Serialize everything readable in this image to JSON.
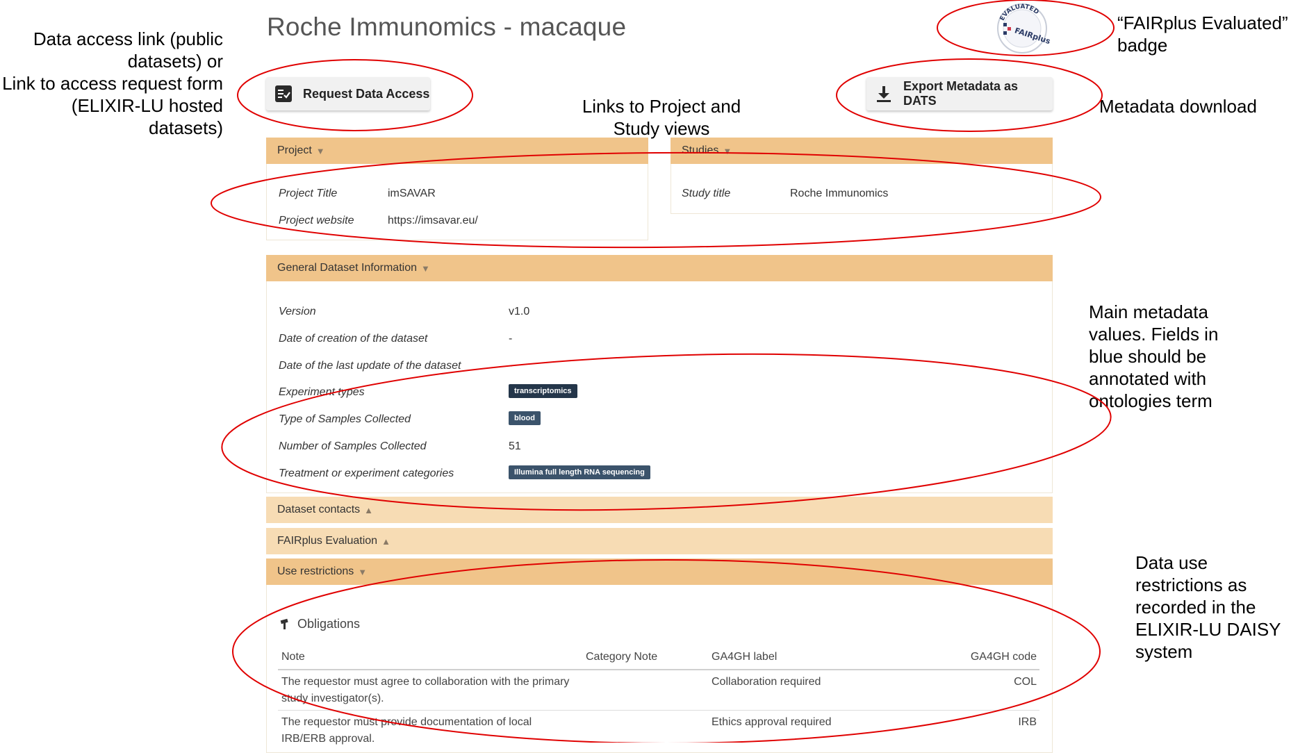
{
  "page": {
    "title": "Roche Immunomics - macaque"
  },
  "actions": {
    "request_access_label": "Request Data Access",
    "export_label": "Export Metadata as DATS"
  },
  "badge": {
    "top_text": "EVALUATED",
    "bottom_text": "FAIRplus"
  },
  "annotations": {
    "access_link": [
      "Data access link (public",
      "datasets) or",
      "Link to access request form",
      "(ELIXIR-LU hosted",
      "datasets)"
    ],
    "project_links": [
      "Links to Project and",
      "Study views"
    ],
    "fairplus_badge": [
      "“FAIRplus Evaluated”",
      "badge"
    ],
    "metadata_download": "Metadata download",
    "main_metadata": [
      "Main metadata",
      "values. Fields in",
      "blue should be",
      "annotated with",
      "ontologies term"
    ],
    "data_use": [
      "Data use",
      "restrictions as",
      "recorded in the",
      "ELIXIR-LU DAISY",
      "system"
    ]
  },
  "project": {
    "heading": "Project",
    "title_label": "Project Title",
    "title_value": "imSAVAR",
    "website_label": "Project website",
    "website_value": "https://imsavar.eu/"
  },
  "studies": {
    "heading": "Studies",
    "title_label": "Study title",
    "title_value": "Roche Immunomics"
  },
  "general": {
    "heading": "General Dataset Information",
    "rows": [
      {
        "label": "Version",
        "value": "v1.0"
      },
      {
        "label": "Date of creation of the dataset",
        "value": "-"
      },
      {
        "label": "Date of the last update of the dataset",
        "value": "-"
      },
      {
        "label": "Experiment types",
        "value": "transcriptomics"
      },
      {
        "label": "Type of Samples Collected",
        "value": "blood"
      },
      {
        "label": "Number of Samples Collected",
        "value": "51"
      },
      {
        "label": "Treatment or experiment categories",
        "value": "Illumina full length RNA sequencing"
      }
    ]
  },
  "collapsed_sections": [
    {
      "heading": "Dataset contacts"
    },
    {
      "heading": "FAIRplus Evaluation"
    }
  ],
  "use_restrictions": {
    "heading": "Use restrictions",
    "obligations_title": "Obligations",
    "columns": [
      "Note",
      "Category Note",
      "GA4GH label",
      "GA4GH code"
    ],
    "rows": [
      {
        "note_line1": "The requestor must agree to collaboration with the primary",
        "note_line2": "study investigator(s).",
        "category_note": "",
        "label": "Collaboration required",
        "code": "COL"
      },
      {
        "note_line1": "The requestor must provide documentation of local",
        "note_line2": "IRB/ERB approval.",
        "category_note": "",
        "label": "Ethics approval required",
        "code": "IRB"
      }
    ]
  },
  "colors": {
    "annotation_red": "#e00000",
    "panel_header": "#f0c48a",
    "panel_header_collapsed": "#f7dcb4",
    "tag_dark": "#24364a"
  }
}
